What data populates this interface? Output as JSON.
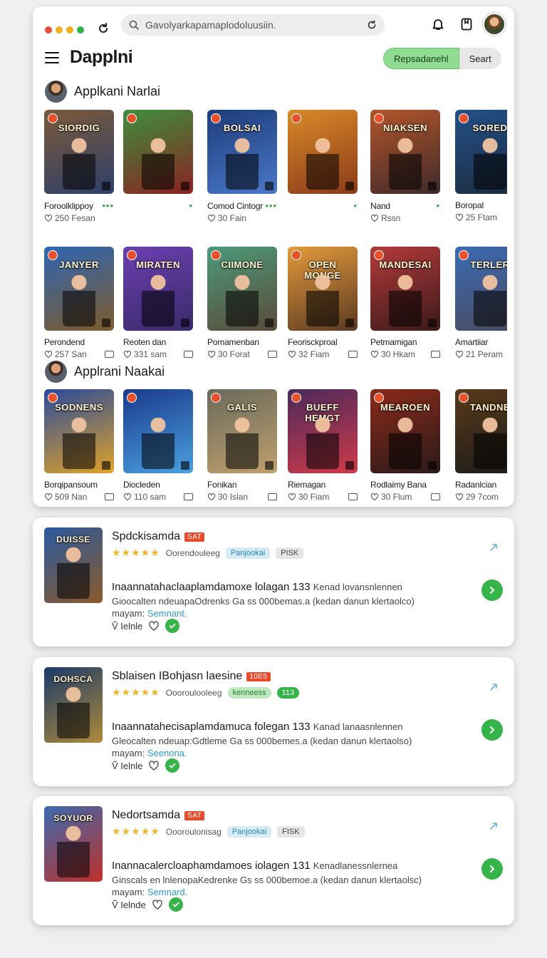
{
  "browser": {
    "traffic_colors": [
      "#e74c3c",
      "#f5b021",
      "#f5b021",
      "#33b249"
    ],
    "url_value": "Gavolyarkapamaplodoluusiin.",
    "icons": [
      "reload-icon",
      "search-icon",
      "refresh-icon",
      "bell-icon",
      "bookmark-icon"
    ]
  },
  "header": {
    "app_title": "Dapplni",
    "segment_a": "Repsadanehl",
    "segment_b": "Seart"
  },
  "section1": {
    "title": "Applkani Narlai",
    "row1": [
      {
        "name": "Foroolklippoy",
        "meta": "250 Fesan",
        "banner": "SIORDIG",
        "extra": "•••",
        "colors": [
          "#7c5a3a",
          "#2d3f6b"
        ]
      },
      {
        "name": "",
        "meta": "",
        "banner": "",
        "extra": "•",
        "colors": [
          "#3d8f3d",
          "#8a2222"
        ]
      },
      {
        "name": "Comod Cintogr",
        "meta": "30 Fain",
        "banner": "BOLSAI",
        "extra": "•••",
        "colors": [
          "#1d3c7a",
          "#4a78c8"
        ]
      },
      {
        "name": "",
        "meta": "",
        "banner": "",
        "extra": "•",
        "colors": [
          "#d98a28",
          "#8a3b1a"
        ]
      },
      {
        "name": "Nand",
        "meta": "Rssn",
        "banner": "NIAKSEN",
        "extra": "•",
        "colors": [
          "#b4552a",
          "#3e2a2a"
        ]
      },
      {
        "name": "Boropal",
        "meta": "25 Ftam",
        "banner": "SORED",
        "extra": "",
        "colors": [
          "#24508a",
          "#1b2a3a"
        ]
      }
    ],
    "row2": [
      {
        "name": "Perondend",
        "meta": "257 San",
        "banner": "JANYER",
        "colors": [
          "#2e66b4",
          "#7d5a2b"
        ]
      },
      {
        "name": "Reoten dan",
        "meta": "331 sam",
        "banner": "MIRATEN",
        "colors": [
          "#6b3fb0",
          "#3a2a6a"
        ]
      },
      {
        "name": "Pomamenban",
        "meta": "30 Forat",
        "banner": "CIIMONE",
        "colors": [
          "#4c9a7a",
          "#5a4a3a"
        ]
      },
      {
        "name": "Feorisckproal",
        "meta": "32 Fiam",
        "banner": "OPEN MONGE",
        "colors": [
          "#e39a3a",
          "#5a3a22"
        ]
      },
      {
        "name": "Petmamigan",
        "meta": "30 Hkam",
        "banner": "MANDESAI",
        "colors": [
          "#b43a3a",
          "#3a1a1a"
        ]
      },
      {
        "name": "Amartiiar",
        "meta": "21 Peram",
        "banner": "TERLER",
        "colors": [
          "#3a6ab4",
          "#4a4a5a"
        ]
      }
    ]
  },
  "section2": {
    "title": "Applrani Naakai",
    "row": [
      {
        "name": "Borqipansoum",
        "meta": "509 Nan",
        "banner": "SODNENS",
        "colors": [
          "#2a4a9a",
          "#e0a32a"
        ]
      },
      {
        "name": "Diocleden",
        "meta": "110 sam",
        "banner": "",
        "colors": [
          "#1a3a8a",
          "#4aa0e0"
        ]
      },
      {
        "name": "Fonikan",
        "meta": "30 Islan",
        "banner": "GALIS",
        "colors": [
          "#6a6a5a",
          "#c0a070"
        ]
      },
      {
        "name": "Riemagan",
        "meta": "30 Fiam",
        "banner": "BUEFF HEMGT",
        "colors": [
          "#4a2a5a",
          "#d03a4a"
        ]
      },
      {
        "name": "Rodlaimy Bana",
        "meta": "30 Flum",
        "banner": "MEAROEN",
        "colors": [
          "#8a2a1a",
          "#2a1a1a"
        ]
      },
      {
        "name": "Radanlcian",
        "meta": "29 7com",
        "banner": "TANDNE",
        "colors": [
          "#5a3a1a",
          "#1a1a1a"
        ]
      }
    ]
  },
  "details": [
    {
      "title": "Spdckisamda",
      "tag": "SAT",
      "stars": "★★★★★",
      "rating_text": "Oorendouleeg",
      "pills": [
        {
          "label": "Panjookai",
          "style": "pill-blue"
        },
        {
          "label": "PISK",
          "style": "pill-grey"
        }
      ],
      "headline": "Inaannatahaclaaplamdamoxe lolagan 133",
      "headline_small": "Kenad lovansnlennen",
      "body": "Gioocalten ndeuapaOdrenks Ga ss 000bemas.a (kedan danun klertaolco)",
      "body2": "mayam:",
      "link": "Semnant.",
      "foot": "Ṽ Ielnle",
      "cover": [
        "#2a5aa0",
        "#8a5a2a"
      ],
      "cover_banner": "DUISSE"
    },
    {
      "title": "Sblaisen IBohjasn laesine",
      "tag": "10E5",
      "stars": "★★★★★",
      "rating_text": "Oooroulooleeg",
      "pills": [
        {
          "label": "kenneess",
          "style": "pill-green"
        },
        {
          "label": "113",
          "style": "pill-green2"
        }
      ],
      "headline": "Inaannatahecisaplamdamuca folegan 133",
      "headline_small": "Kanad lanaasnlennen",
      "body": "Gleocalten ndeuap:Gdtleme Ga ss 000bemes.a (kedan danun klertaolso)",
      "body2": "mayam:",
      "link": "Seenona.",
      "foot": "Ṽ Ielnle",
      "cover": [
        "#1a3a6a",
        "#b08a3a"
      ],
      "cover_banner": "DOHSCA"
    },
    {
      "title": "Nedortsamda",
      "tag": "SAT",
      "stars": "★★★★★",
      "rating_text": "Oooroulonisag",
      "pills": [
        {
          "label": "Panjookai",
          "style": "pill-blue"
        },
        {
          "label": "FISK",
          "style": "pill-grey"
        }
      ],
      "headline": "Inannacalercloaphamdamoes iolagen 131",
      "headline_small": "Kenadlanessnlernea",
      "body": "Ginscals en lnlenopaKedrenke Gs ss 000bemoe.a (kedan danun klertaolsc)",
      "body2": "mayam:",
      "link": "Semnard.",
      "foot": "Ṽ Ielnde",
      "cover": [
        "#3a6ab0",
        "#c0302a"
      ],
      "cover_banner": "SOYUOR"
    }
  ]
}
